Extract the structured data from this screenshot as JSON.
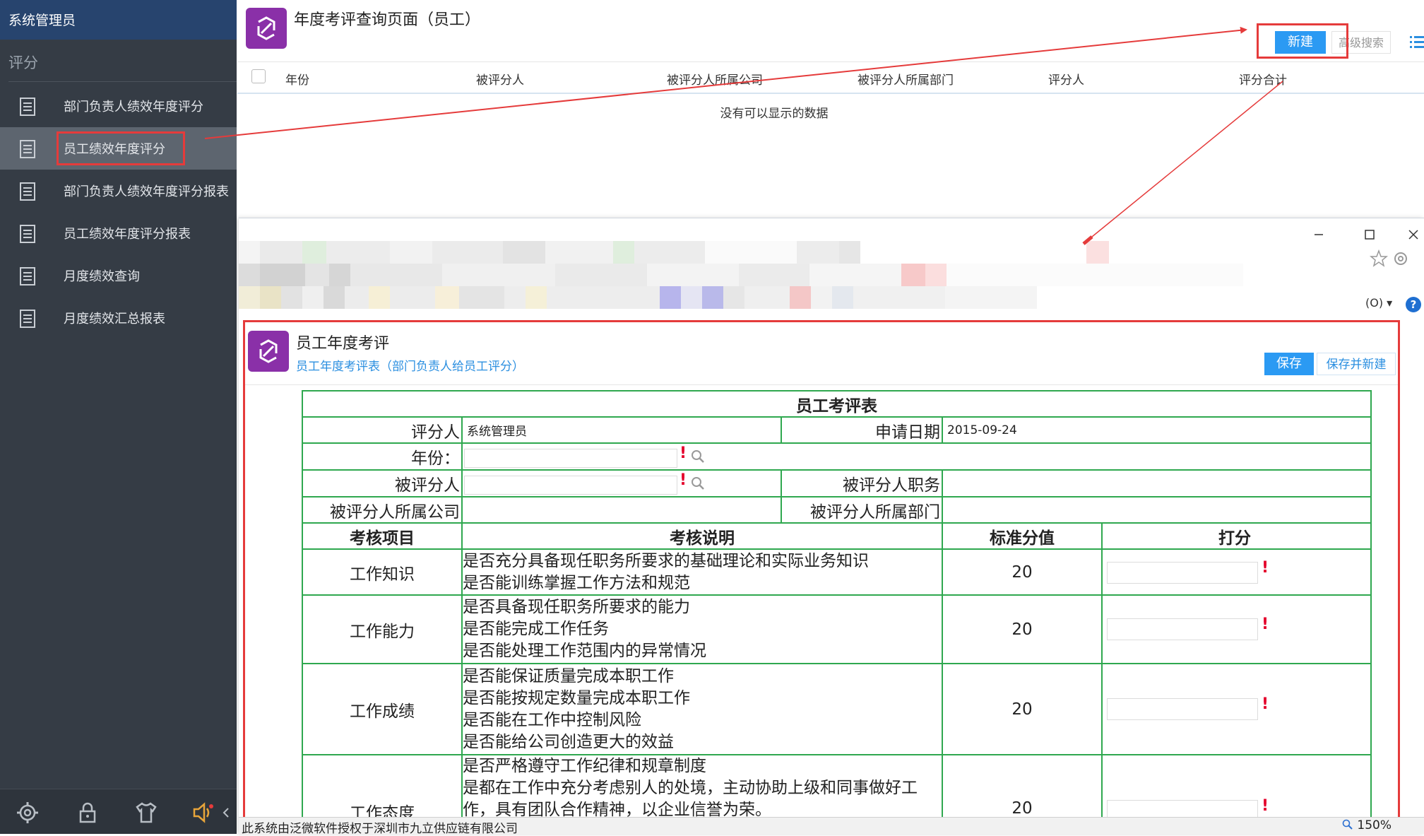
{
  "sidebar": {
    "user_name": "系统管理员",
    "section_title": "评分",
    "items": [
      {
        "label": "部门负责人绩效年度评分",
        "icon": "document-icon"
      },
      {
        "label": "员工绩效年度评分",
        "icon": "document-icon",
        "active": true
      },
      {
        "label": "部门负责人绩效年度评分报表",
        "icon": "document-icon"
      },
      {
        "label": "员工绩效年度评分报表",
        "icon": "document-icon"
      },
      {
        "label": "月度绩效查询",
        "icon": "document-icon"
      },
      {
        "label": "月度绩效汇总报表",
        "icon": "document-icon"
      }
    ],
    "bottom_icons": [
      "gear-icon",
      "lock-icon",
      "shirt-icon",
      "speaker-icon",
      "collapse-arrow-icon"
    ]
  },
  "main": {
    "page_title": "年度考评查询页面（员工）",
    "new_button": "新建",
    "advanced_search": "高级搜索",
    "columns": [
      "年份",
      "被评分人",
      "被评分人所属公司",
      "被评分人所属部门",
      "评分人",
      "评分合计"
    ],
    "empty_message": "没有可以显示的数据"
  },
  "popup": {
    "o_menu": "(O)",
    "title": "员工年度考评",
    "subtitle": "员工年度考评表（部门负责人给员工评分）",
    "save_button": "保存",
    "save_new_button": "保存并新建",
    "form": {
      "title": "员工考评表",
      "rater_label": "评分人",
      "rater_value": "系统管理员",
      "apply_date_label": "申请日期",
      "apply_date_value": "2015-09-24",
      "year_label": "年份：",
      "ratee_label": "被评分人",
      "ratee_position_label": "被评分人职务",
      "ratee_company_label": "被评分人所属公司",
      "ratee_dept_label": "被评分人所属部门",
      "headers": [
        "考核项目",
        "考核说明",
        "标准分值",
        "打分"
      ],
      "rows": [
        {
          "item": "工作知识",
          "lines": [
            "是否充分具备现任职务所要求的基础理论和实际业务知识",
            "是否能训练掌握工作方法和规范"
          ],
          "score": "20"
        },
        {
          "item": "工作能力",
          "lines": [
            "是否具备现任职务所要求的能力",
            "是否能完成工作任务",
            "是否能处理工作范围内的异常情况"
          ],
          "score": "20"
        },
        {
          "item": "工作成绩",
          "lines": [
            "是否能保证质量完成本职工作",
            "是否能按规定数量完成本职工作",
            "是否能在工作中控制风险",
            "是否能给公司创造更大的效益"
          ],
          "score": "20"
        },
        {
          "item": "工作态度",
          "lines": [
            "是否严格遵守工作纪律和规章制度",
            "是都在工作中充分考虑别人的处境，主动协助上级和同事做好工",
            "作，具有团队合作精神，以企业信誉为荣。"
          ],
          "score": "20"
        }
      ]
    }
  },
  "status": {
    "text": "此系统由泛微软件授权于深圳市九立供应链有限公司",
    "zoom": "150%"
  },
  "colors": {
    "sidebar_bg": "#353c45",
    "user_bar_bg": "#27446e",
    "accent_blue": "#2b9af3",
    "highlight_red": "#e53b3b",
    "form_green": "#2fa84f",
    "logo_purple": "#8a30a8"
  }
}
